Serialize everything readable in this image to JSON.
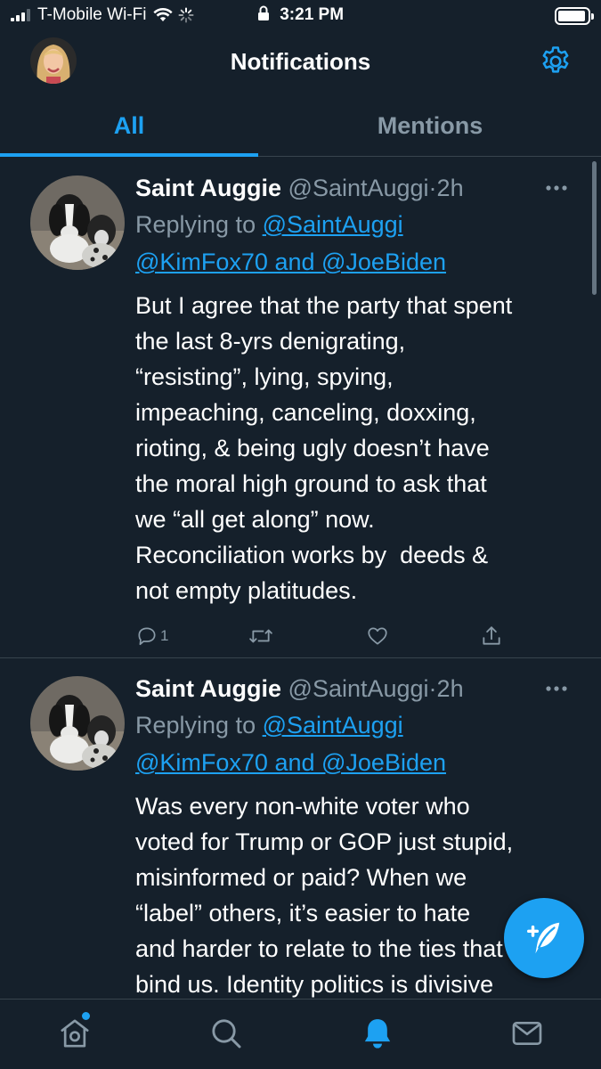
{
  "status_bar": {
    "carrier": "T-Mobile Wi-Fi",
    "time": "3:21 PM",
    "battery_level": 0.95
  },
  "header": {
    "title": "Notifications",
    "settings_icon": "gear-icon"
  },
  "tabs": [
    {
      "label": "All",
      "active": true
    },
    {
      "label": "Mentions",
      "active": false
    }
  ],
  "tweets": [
    {
      "name": "Saint Auggie",
      "handle": "@SaintAuggi",
      "dot": "·",
      "time": "2h",
      "replying_prefix": "Replying to",
      "replying_to_1": "@SaintAuggi",
      "replying_to_2": "@KimFox70 and @JoeBiden",
      "lines": [
        "But I agree that the party that spent",
        "the last 8-yrs denigrating,",
        "“resisting”, lying, spying,",
        "impeaching, canceling, doxxing,",
        "rioting, & being ugly doesn’t have",
        "the moral high ground to ask that",
        "we “all get along” now.",
        "Reconciliation works by  deeds &",
        "not empty platitudes."
      ],
      "reply_count": "1"
    },
    {
      "name": "Saint Auggie",
      "handle": "@SaintAuggi",
      "dot": "·",
      "time": "2h",
      "replying_prefix": "Replying to",
      "replying_to_1": "@SaintAuggi",
      "replying_to_2": "@KimFox70 and @JoeBiden",
      "lines": [
        "Was every non-white voter who",
        "voted for Trump or GOP just stupid,",
        "misinformed or paid? When we",
        "“label” others, it’s easier to hate",
        "and harder to relate to the ties that",
        "bind us. Identity politics is divisive"
      ],
      "reply_count": ""
    }
  ],
  "bottom_nav": [
    "home-icon",
    "search-icon",
    "notifications-bell-icon",
    "messages-icon"
  ],
  "colors": {
    "background": "#15202b",
    "accent": "#1da1f2",
    "secondary_text": "#8899a6",
    "divider": "#38444d"
  }
}
